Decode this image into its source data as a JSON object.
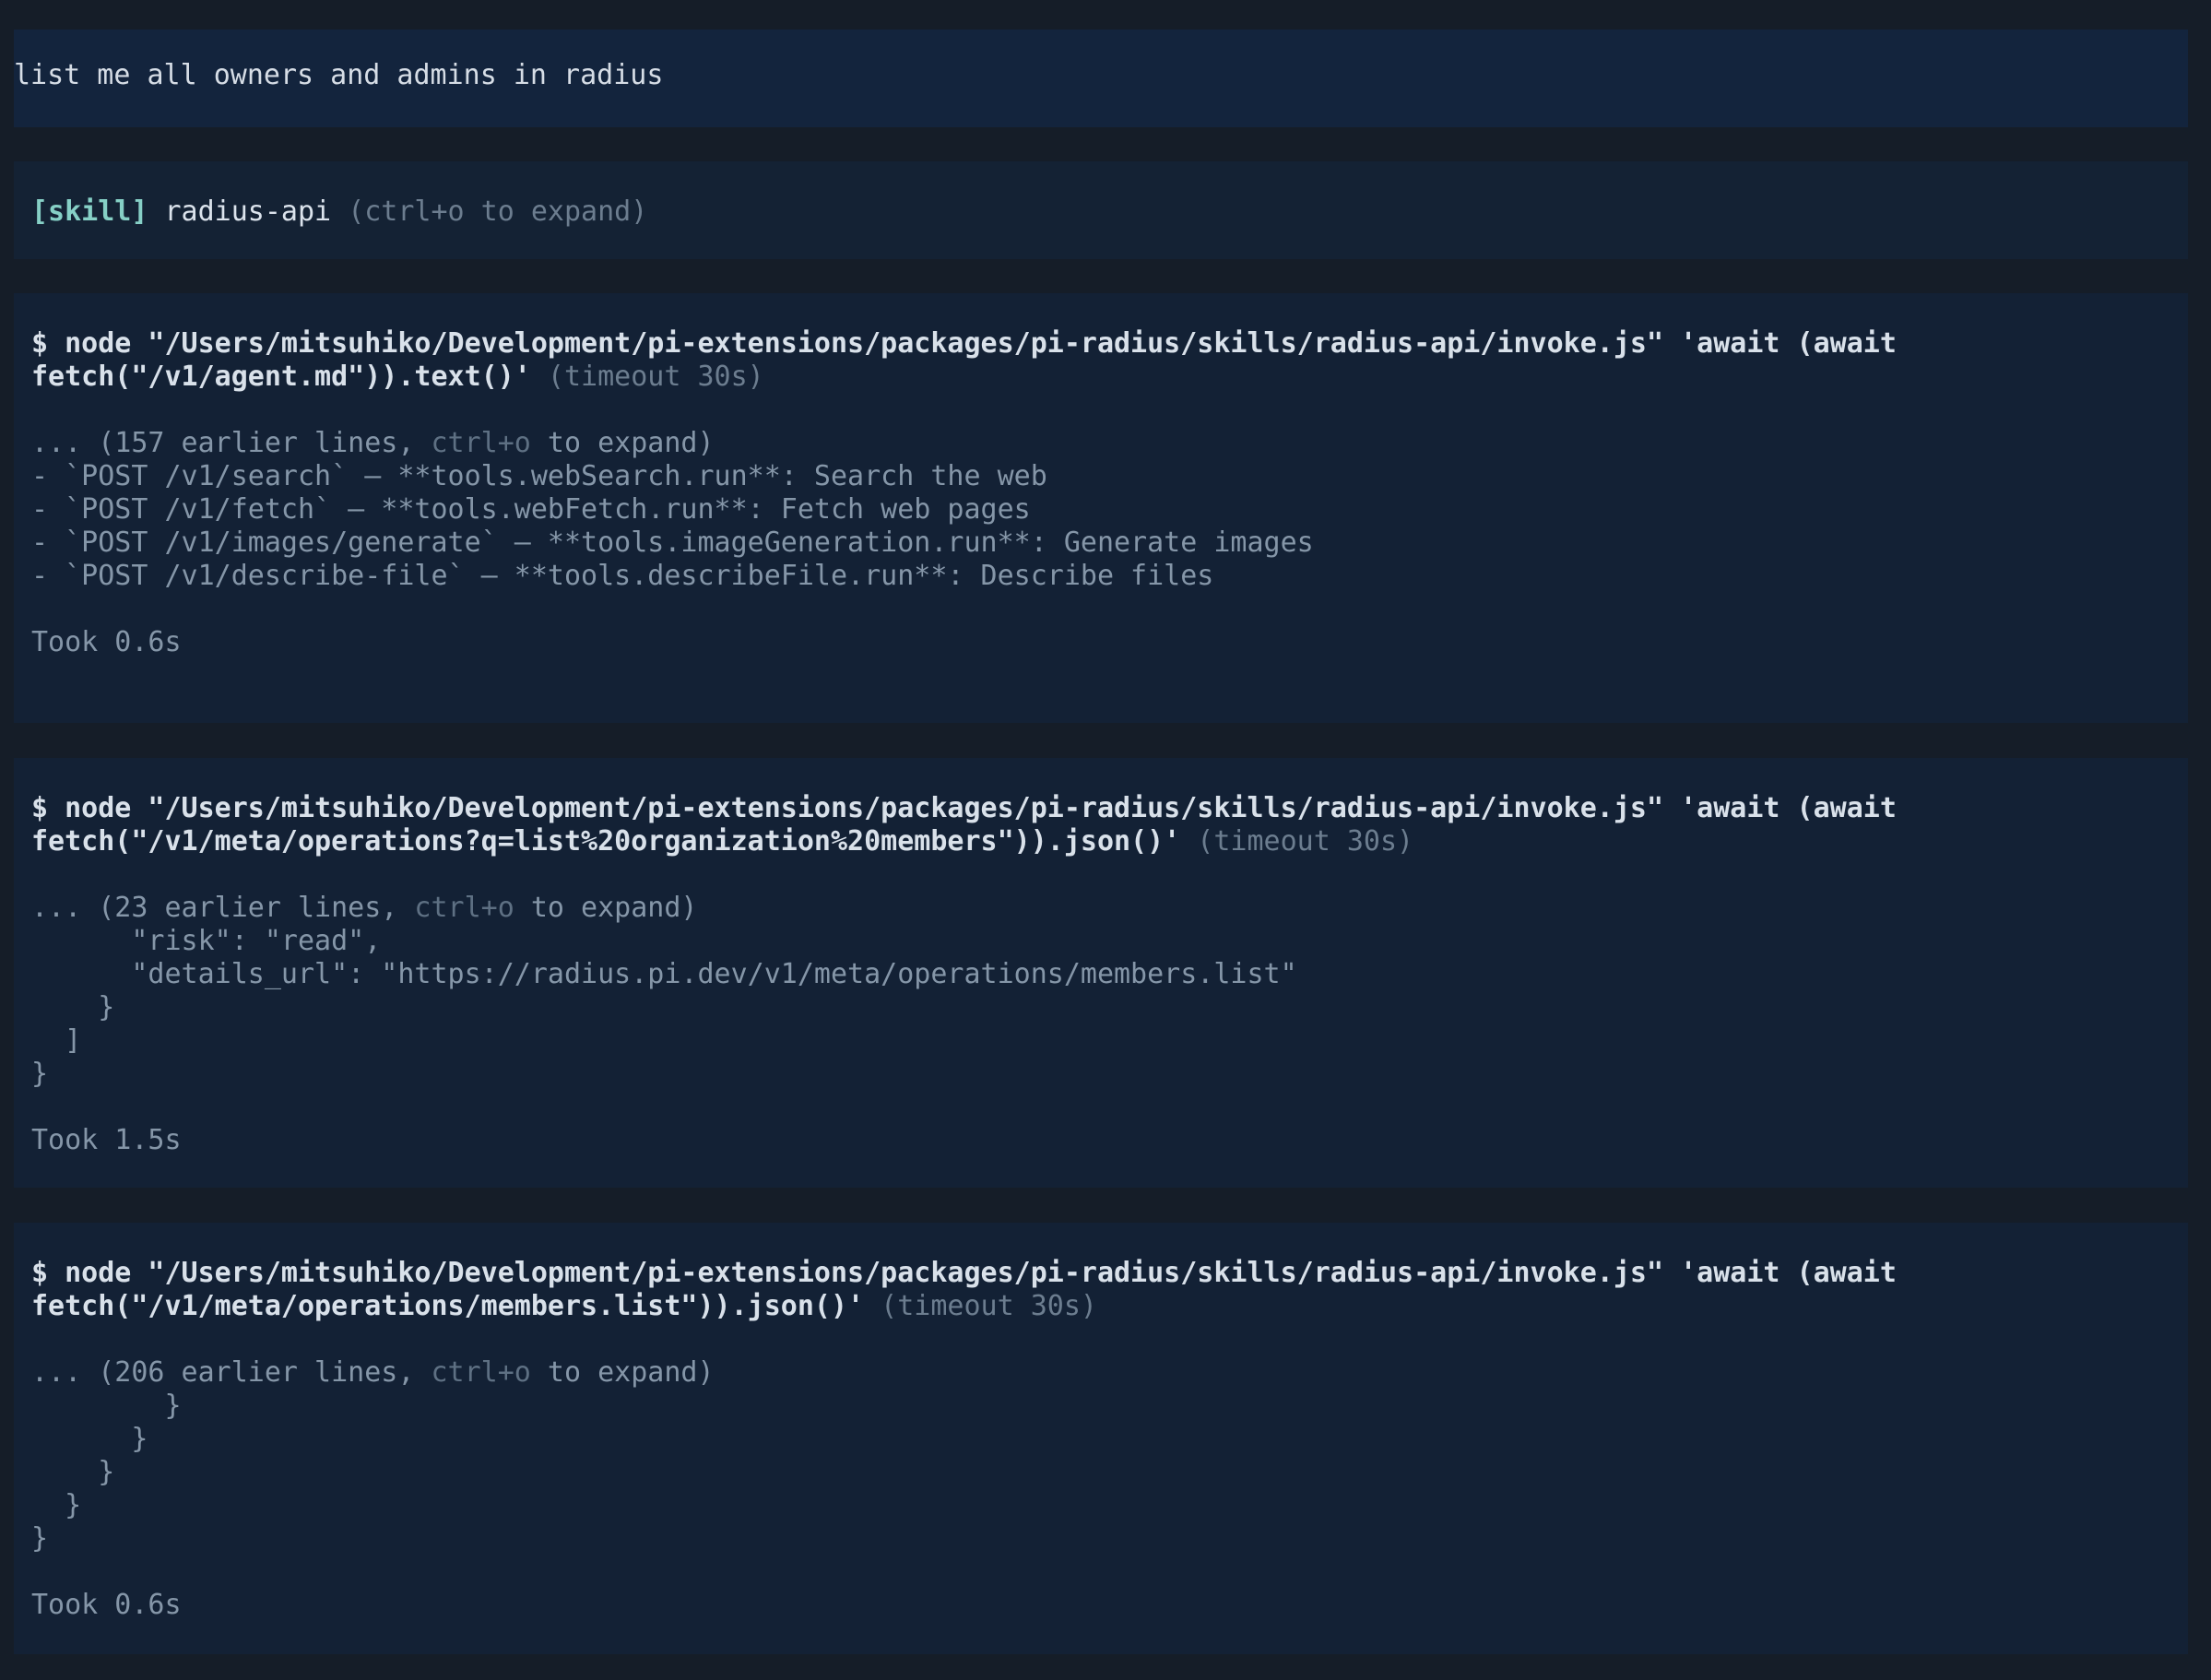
{
  "user_message": "list me all owners and admins in radius",
  "skill": {
    "tag": "[skill]",
    "name": "radius-api",
    "hint": "(ctrl+o to expand)"
  },
  "tool_calls": [
    {
      "command_line1": "$ node \"/Users/mitsuhiko/Development/pi-extensions/packages/pi-radius/skills/radius-api/invoke.js\" 'await (await",
      "command_line2": "fetch(\"/v1/agent.md\")).text()'",
      "timeout": " (timeout 30s)",
      "earlier_prefix": "... (157 earlier lines, ",
      "earlier_hint": "ctrl+o",
      "earlier_suffix": " to expand)",
      "output_lines": [
        "",
        "- `POST /v1/search` — **tools.webSearch.run**: Search the web",
        "- `POST /v1/fetch` — **tools.webFetch.run**: Fetch web pages",
        "- `POST /v1/images/generate` — **tools.imageGeneration.run**: Generate images",
        "- `POST /v1/describe-file` — **tools.describeFile.run**: Describe files"
      ],
      "took": "Took 0.6s"
    },
    {
      "command_line1": "$ node \"/Users/mitsuhiko/Development/pi-extensions/packages/pi-radius/skills/radius-api/invoke.js\" 'await (await",
      "command_line2": "fetch(\"/v1/meta/operations?q=list%20organization%20members\")).json()'",
      "timeout": " (timeout 30s)",
      "earlier_prefix": "... (23 earlier lines, ",
      "earlier_hint": "ctrl+o",
      "earlier_suffix": " to expand)",
      "output_lines": [
        "      \"risk\": \"read\",",
        "      \"details_url\": \"https://radius.pi.dev/v1/meta/operations/members.list\"",
        "    }",
        "  ]",
        "}"
      ],
      "took": "Took 1.5s"
    },
    {
      "command_line1": "$ node \"/Users/mitsuhiko/Development/pi-extensions/packages/pi-radius/skills/radius-api/invoke.js\" 'await (await",
      "command_line2": "fetch(\"/v1/meta/operations/members.list\")).json()'",
      "timeout": " (timeout 30s)",
      "earlier_prefix": "... (206 earlier lines, ",
      "earlier_hint": "ctrl+o",
      "earlier_suffix": " to expand)",
      "output_lines": [
        "        }",
        "      }",
        "    }",
        "  }",
        "}"
      ],
      "took": "Took 0.6s"
    }
  ]
}
